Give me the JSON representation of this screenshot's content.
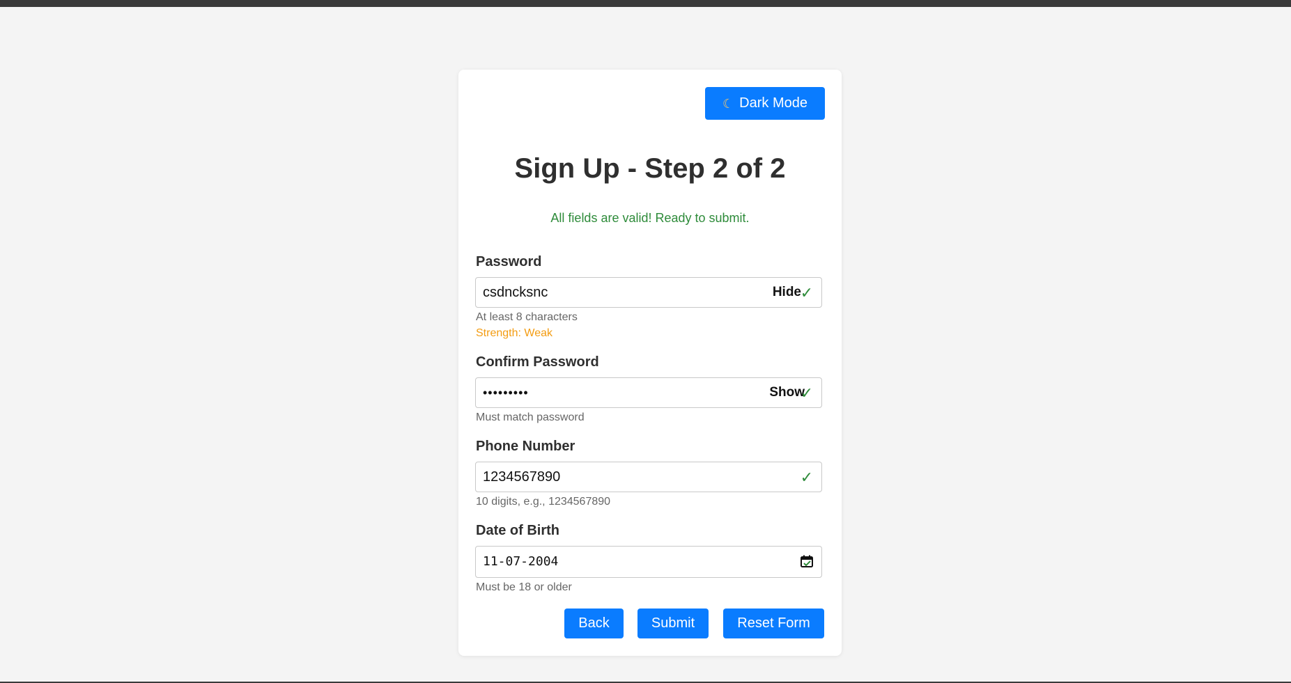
{
  "theme_toggle": {
    "icon": "moon-icon",
    "label": "Dark Mode"
  },
  "title": "Sign Up - Step 2 of 2",
  "status_message": "All fields are valid! Ready to submit.",
  "fields": {
    "password": {
      "label": "Password",
      "value": "csdncksnc",
      "toggle_label": "Hide",
      "hint": "At least 8 characters",
      "strength": "Strength: Weak"
    },
    "confirm_password": {
      "label": "Confirm Password",
      "value": "•••••••••",
      "toggle_label": "Show",
      "hint": "Must match password"
    },
    "phone": {
      "label": "Phone Number",
      "value": "1234567890",
      "hint": "10 digits, e.g., 1234567890"
    },
    "dob": {
      "label": "Date of Birth",
      "value": "11-07-2004",
      "hint": "Must be 18 or older"
    }
  },
  "buttons": {
    "back": "Back",
    "submit": "Submit",
    "reset": "Reset Form"
  },
  "valid_mark": "✓",
  "colors": {
    "primary": "#0a7cff",
    "success": "#2e8b3a",
    "warning": "#f39c12",
    "background": "#f4f4f4"
  }
}
